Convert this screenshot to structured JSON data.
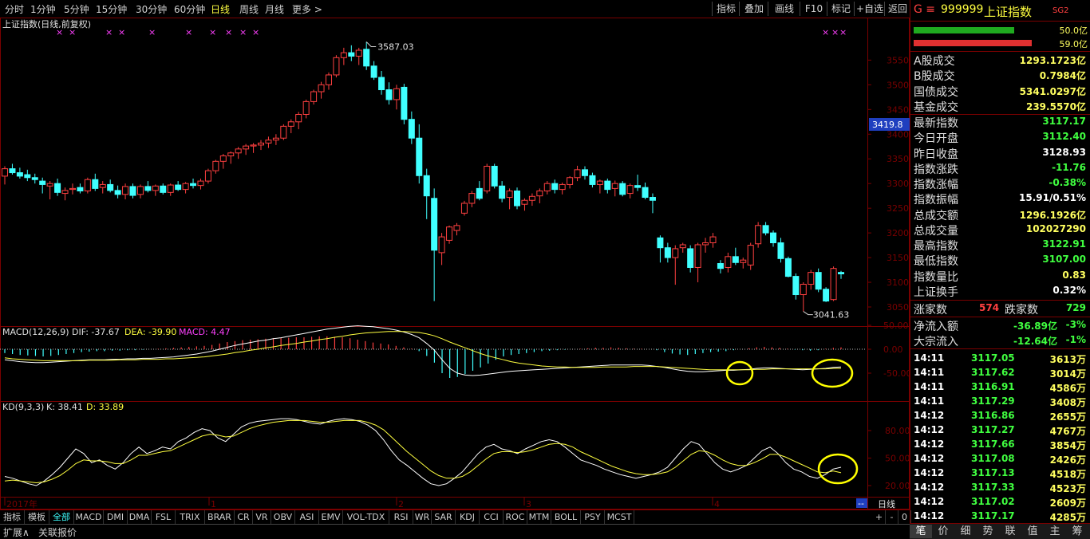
{
  "toolbar": {
    "periods": [
      "分时",
      "1分钟",
      "5分钟",
      "15分钟",
      "30分钟",
      "60分钟",
      "日线",
      "周线",
      "月线",
      "更多 >"
    ],
    "active_period": "日线",
    "buttons": [
      "指标",
      "叠加",
      "画线",
      "F10",
      "标记",
      "+自选",
      "返回"
    ]
  },
  "main_chart": {
    "title": "上证指数(日线,前复权)",
    "high_label": "3587.03",
    "low_label": "3041.63",
    "current_price_tag": "3419.8",
    "price_ticks": [
      "3550",
      "3500",
      "3450",
      "3400",
      "3350",
      "3300",
      "3250",
      "3200",
      "3150",
      "3100",
      "3050"
    ]
  },
  "macd": {
    "label": "MACD(12,26,9)",
    "dif": "DIF: -37.67",
    "dea": "DEA: -39.90",
    "macd": "MACD: 4.47",
    "ticks": [
      "50.00",
      "0.00",
      "-50.00"
    ]
  },
  "kd": {
    "label": "KD(9,3,3)",
    "k": "K: 38.41",
    "d": "D: 33.89",
    "ticks": [
      "80.00",
      "50.00",
      "20.00"
    ]
  },
  "time_axis": {
    "labels": [
      "2017年",
      "1",
      "2",
      "3",
      "4"
    ],
    "period_label": "日线",
    "expand_btn": "--"
  },
  "indicator_tabs": [
    "指标",
    "模板",
    "全部",
    "MACD",
    "DMI",
    "DMA",
    "FSL",
    "TRIX",
    "BRAR",
    "CR",
    "VR",
    "OBV",
    "ASI",
    "EMV",
    "VOL-TDX",
    "RSI",
    "WR",
    "SAR",
    "KDJ",
    "CCI",
    "ROC",
    "MTM",
    "BOLL",
    "PSY",
    "MCST"
  ],
  "active_tab": "全部",
  "bottom_bar": {
    "left": "扩展∧",
    "right": "关联报价"
  },
  "zoom_controls": [
    "+",
    "-",
    "0"
  ],
  "right_panel": {
    "code_prefix": "G ≡",
    "code": "999999",
    "name": "上证指数",
    "tag": "SG2",
    "bar_values": [
      "50.0亿",
      "59.0亿"
    ],
    "stats": [
      {
        "label": "A股成交",
        "value": "1293.1723亿",
        "color": "#ffff60"
      },
      {
        "label": "B股成交",
        "value": "0.7984亿",
        "color": "#ffff60"
      },
      {
        "label": "国债成交",
        "value": "5341.0297亿",
        "color": "#ffff60"
      },
      {
        "label": "基金成交",
        "value": "239.5570亿",
        "color": "#ffff60"
      },
      {
        "label": "最新指数",
        "value": "3117.17",
        "color": "#40ff40"
      },
      {
        "label": "今日开盘",
        "value": "3112.40",
        "color": "#40ff40"
      },
      {
        "label": "昨日收盘",
        "value": "3128.93",
        "color": "#ffffff"
      },
      {
        "label": "指数涨跌",
        "value": "-11.76",
        "color": "#40ff40"
      },
      {
        "label": "指数涨幅",
        "value": "-0.38%",
        "color": "#40ff40"
      },
      {
        "label": "指数振幅",
        "value": "15.91/0.51%",
        "color": "#ffffff"
      },
      {
        "label": "总成交额",
        "value": "1296.1926亿",
        "color": "#ffff60"
      },
      {
        "label": "总成交量",
        "value": "102027290",
        "color": "#ffff60"
      },
      {
        "label": "最高指数",
        "value": "3122.91",
        "color": "#40ff40"
      },
      {
        "label": "最低指数",
        "value": "3107.00",
        "color": "#40ff40"
      },
      {
        "label": "指数量比",
        "value": "0.83",
        "color": "#ffff60"
      },
      {
        "label": "上证换手",
        "value": "0.32%",
        "color": "#ffffff"
      }
    ],
    "up_label": "涨家数",
    "up_value": "574",
    "down_label": "跌家数",
    "down_value": "729",
    "flows": [
      {
        "label": "净流入额",
        "value": "-36.89亿",
        "pct": "-3%"
      },
      {
        "label": "大宗流入",
        "value": "-12.64亿",
        "pct": "-1%"
      }
    ],
    "ticks": [
      {
        "time": "14:11",
        "price": "3117.05",
        "vol": "3613万"
      },
      {
        "time": "14:11",
        "price": "3117.62",
        "vol": "3014万"
      },
      {
        "time": "14:11",
        "price": "3116.91",
        "vol": "4586万"
      },
      {
        "time": "14:11",
        "price": "3117.29",
        "vol": "3408万"
      },
      {
        "time": "14:12",
        "price": "3116.86",
        "vol": "2655万"
      },
      {
        "time": "14:12",
        "price": "3117.27",
        "vol": "4767万"
      },
      {
        "time": "14:12",
        "price": "3117.66",
        "vol": "3854万"
      },
      {
        "time": "14:12",
        "price": "3117.08",
        "vol": "2426万"
      },
      {
        "time": "14:12",
        "price": "3117.13",
        "vol": "4518万"
      },
      {
        "time": "14:12",
        "price": "3117.33",
        "vol": "4523万"
      },
      {
        "time": "14:12",
        "price": "3117.02",
        "vol": "2609万"
      },
      {
        "time": "14:12",
        "price": "3117.17",
        "vol": "4285万"
      }
    ],
    "bottom_tabs": [
      "笔",
      "价",
      "细",
      "势",
      "联",
      "值",
      "主",
      "筹"
    ],
    "active_bottom_tab": "笔"
  },
  "colors": {
    "up": "#ff4040",
    "down": "#40ffff",
    "bg": "#000000",
    "border": "#7a0000",
    "dif": "#ffffff",
    "dea": "#ffff40",
    "highlight": "#ffff00"
  },
  "candles": [
    [
      3315,
      3335,
      3298,
      3330
    ],
    [
      3330,
      3340,
      3318,
      3322
    ],
    [
      3322,
      3332,
      3310,
      3315
    ],
    [
      3318,
      3328,
      3305,
      3312
    ],
    [
      3312,
      3320,
      3300,
      3308
    ],
    [
      3305,
      3312,
      3280,
      3298
    ],
    [
      3295,
      3305,
      3268,
      3300
    ],
    [
      3300,
      3310,
      3275,
      3282
    ],
    [
      3280,
      3292,
      3266,
      3286
    ],
    [
      3288,
      3300,
      3278,
      3290
    ],
    [
      3292,
      3300,
      3280,
      3285
    ],
    [
      3285,
      3312,
      3280,
      3308
    ],
    [
      3308,
      3320,
      3285,
      3290
    ],
    [
      3292,
      3305,
      3280,
      3298
    ],
    [
      3298,
      3308,
      3282,
      3286
    ],
    [
      3286,
      3296,
      3270,
      3278
    ],
    [
      3278,
      3300,
      3268,
      3294
    ],
    [
      3294,
      3300,
      3270,
      3276
    ],
    [
      3278,
      3298,
      3270,
      3294
    ],
    [
      3294,
      3305,
      3282,
      3286
    ],
    [
      3286,
      3298,
      3275,
      3295
    ],
    [
      3295,
      3300,
      3278,
      3282
    ],
    [
      3282,
      3300,
      3275,
      3297
    ],
    [
      3297,
      3305,
      3285,
      3288
    ],
    [
      3288,
      3303,
      3280,
      3300
    ],
    [
      3300,
      3310,
      3290,
      3296
    ],
    [
      3296,
      3310,
      3288,
      3305
    ],
    [
      3305,
      3330,
      3300,
      3326
    ],
    [
      3326,
      3348,
      3320,
      3345
    ],
    [
      3345,
      3360,
      3330,
      3356
    ],
    [
      3356,
      3365,
      3340,
      3362
    ],
    [
      3362,
      3374,
      3350,
      3370
    ],
    [
      3370,
      3380,
      3358,
      3376
    ],
    [
      3376,
      3382,
      3362,
      3378
    ],
    [
      3378,
      3388,
      3368,
      3382
    ],
    [
      3382,
      3395,
      3372,
      3388
    ],
    [
      3388,
      3400,
      3378,
      3392
    ],
    [
      3392,
      3420,
      3388,
      3416
    ],
    [
      3416,
      3430,
      3402,
      3425
    ],
    [
      3425,
      3445,
      3410,
      3440
    ],
    [
      3440,
      3470,
      3432,
      3466
    ],
    [
      3466,
      3490,
      3460,
      3486
    ],
    [
      3486,
      3506,
      3472,
      3500
    ],
    [
      3500,
      3525,
      3490,
      3520
    ],
    [
      3520,
      3560,
      3515,
      3555
    ],
    [
      3555,
      3575,
      3540,
      3565
    ],
    [
      3565,
      3580,
      3548,
      3558
    ],
    [
      3558,
      3575,
      3540,
      3570
    ],
    [
      3572,
      3587,
      3530,
      3538
    ],
    [
      3538,
      3548,
      3510,
      3515
    ],
    [
      3515,
      3528,
      3480,
      3490
    ],
    [
      3490,
      3505,
      3460,
      3470
    ],
    [
      3470,
      3500,
      3450,
      3492
    ],
    [
      3495,
      3502,
      3420,
      3430
    ],
    [
      3430,
      3446,
      3380,
      3392
    ],
    [
      3392,
      3420,
      3300,
      3316
    ],
    [
      3316,
      3330,
      3228,
      3275
    ],
    [
      3270,
      3290,
      3062,
      3165
    ],
    [
      3160,
      3200,
      3135,
      3192
    ],
    [
      3185,
      3215,
      3178,
      3212
    ],
    [
      3205,
      3220,
      3195,
      3215
    ],
    [
      3240,
      3265,
      3235,
      3260
    ],
    [
      3260,
      3285,
      3252,
      3280
    ],
    [
      3290,
      3305,
      3266,
      3270
    ],
    [
      3285,
      3340,
      3280,
      3335
    ],
    [
      3335,
      3340,
      3290,
      3295
    ],
    [
      3295,
      3305,
      3262,
      3270
    ],
    [
      3272,
      3290,
      3248,
      3285
    ],
    [
      3285,
      3292,
      3248,
      3255
    ],
    [
      3258,
      3270,
      3245,
      3266
    ],
    [
      3266,
      3280,
      3255,
      3274
    ],
    [
      3275,
      3290,
      3260,
      3285
    ],
    [
      3285,
      3305,
      3278,
      3300
    ],
    [
      3300,
      3308,
      3280,
      3288
    ],
    [
      3288,
      3302,
      3278,
      3298
    ],
    [
      3298,
      3315,
      3290,
      3312
    ],
    [
      3312,
      3336,
      3305,
      3328
    ],
    [
      3328,
      3335,
      3308,
      3316
    ],
    [
      3316,
      3322,
      3292,
      3298
    ],
    [
      3298,
      3308,
      3280,
      3305
    ],
    [
      3305,
      3310,
      3280,
      3288
    ],
    [
      3290,
      3306,
      3274,
      3300
    ],
    [
      3300,
      3305,
      3274,
      3278
    ],
    [
      3280,
      3300,
      3270,
      3296
    ],
    [
      3296,
      3318,
      3285,
      3292
    ],
    [
      3292,
      3302,
      3268,
      3272
    ],
    [
      3272,
      3280,
      3240,
      3266
    ],
    [
      3190,
      3195,
      3140,
      3170
    ],
    [
      3170,
      3180,
      3140,
      3150
    ],
    [
      3150,
      3175,
      3095,
      3168
    ],
    [
      3170,
      3180,
      3160,
      3176
    ],
    [
      3168,
      3175,
      3120,
      3130
    ],
    [
      3130,
      3180,
      3100,
      3176
    ],
    [
      3176,
      3190,
      3160,
      3180
    ],
    [
      3180,
      3200,
      3170,
      3192
    ],
    [
      3138,
      3145,
      3118,
      3128
    ],
    [
      3130,
      3160,
      3120,
      3152
    ],
    [
      3152,
      3170,
      3135,
      3140
    ],
    [
      3140,
      3150,
      3128,
      3145
    ],
    [
      3135,
      3180,
      3125,
      3175
    ],
    [
      3178,
      3222,
      3170,
      3215
    ],
    [
      3215,
      3222,
      3195,
      3200
    ],
    [
      3200,
      3205,
      3172,
      3180
    ],
    [
      3180,
      3190,
      3140,
      3148
    ],
    [
      3148,
      3152,
      3110,
      3112
    ],
    [
      3112,
      3118,
      3065,
      3075
    ],
    [
      3075,
      3100,
      3041,
      3096
    ],
    [
      3096,
      3125,
      3085,
      3120
    ],
    [
      3120,
      3128,
      3080,
      3086
    ],
    [
      3086,
      3090,
      3060,
      3062
    ],
    [
      3065,
      3132,
      3062,
      3128
    ],
    [
      3120,
      3123,
      3107,
      3117
    ]
  ],
  "macd_hist": [
    -8,
    -10,
    -12,
    -13,
    -14,
    -15,
    -14,
    -12,
    -10,
    -8,
    -6,
    -5,
    -4,
    -4,
    -3,
    -3,
    -2,
    -2,
    -1,
    0,
    1,
    2,
    3,
    4,
    5,
    6,
    7,
    9,
    12,
    15,
    17,
    19,
    20,
    21,
    22,
    23,
    24,
    24,
    25,
    25,
    26,
    27,
    27,
    26,
    25,
    23,
    20,
    17,
    14,
    12,
    10,
    7,
    4,
    1,
    -4,
    -14,
    -28,
    -50,
    -60,
    -58,
    -52,
    -45,
    -38,
    -30,
    -22,
    -15,
    -12,
    -10,
    -8,
    -6,
    -4,
    -3,
    -2,
    -1,
    0,
    1,
    2,
    3,
    3,
    4,
    3,
    2,
    1,
    1,
    0,
    -2,
    -6,
    -9,
    -11,
    -12,
    -10,
    -8,
    -6,
    -5,
    -4,
    -2,
    0,
    2,
    4,
    5,
    4,
    3,
    1,
    -1,
    -2,
    -3,
    -2,
    1,
    3,
    4
  ],
  "dif_line": [
    -22,
    -24,
    -26,
    -27,
    -28,
    -28,
    -27,
    -26,
    -25,
    -24,
    -23,
    -22,
    -22,
    -22,
    -21,
    -21,
    -20,
    -20,
    -19,
    -19,
    -18,
    -17,
    -16,
    -14,
    -12,
    -10,
    -7,
    -4,
    0,
    4,
    8,
    11,
    14,
    17,
    19,
    22,
    24,
    27,
    30,
    33,
    36,
    39,
    42,
    44,
    46,
    48,
    49,
    48,
    47,
    45,
    43,
    40,
    36,
    31,
    24,
    12,
    -2,
    -22,
    -40,
    -50,
    -54,
    -55,
    -54,
    -52,
    -50,
    -48,
    -46,
    -45,
    -44,
    -43,
    -42,
    -41,
    -40,
    -39,
    -38,
    -37,
    -36,
    -35,
    -34,
    -33,
    -33,
    -33,
    -33,
    -33,
    -34,
    -36,
    -38,
    -41,
    -44,
    -46,
    -47,
    -47,
    -46,
    -45,
    -44,
    -44,
    -43,
    -42,
    -40,
    -39,
    -39,
    -40,
    -41,
    -42,
    -43,
    -42,
    -41,
    -40,
    -38,
    -37
  ],
  "dea_line": [
    -18,
    -20,
    -21,
    -22,
    -23,
    -24,
    -24,
    -24,
    -24,
    -24,
    -24,
    -23,
    -23,
    -23,
    -23,
    -22,
    -22,
    -22,
    -21,
    -21,
    -21,
    -20,
    -20,
    -19,
    -18,
    -17,
    -16,
    -14,
    -12,
    -10,
    -7,
    -5,
    -2,
    0,
    3,
    5,
    8,
    10,
    12,
    15,
    17,
    20,
    22,
    25,
    27,
    30,
    32,
    34,
    35,
    36,
    37,
    37,
    37,
    36,
    35,
    32,
    28,
    22,
    15,
    9,
    3,
    -3,
    -9,
    -14,
    -18,
    -22,
    -26,
    -29,
    -31,
    -33,
    -35,
    -36,
    -37,
    -37,
    -38,
    -38,
    -38,
    -38,
    -37,
    -37,
    -37,
    -37,
    -36,
    -36,
    -36,
    -36,
    -37,
    -38,
    -39,
    -40,
    -41,
    -42,
    -43,
    -43,
    -43,
    -43,
    -43,
    -43,
    -42,
    -42,
    -41,
    -41,
    -41,
    -41,
    -41,
    -41,
    -41,
    -41,
    -40,
    -40
  ],
  "k_line": [
    30,
    28,
    25,
    22,
    20,
    25,
    32,
    40,
    50,
    60,
    55,
    45,
    48,
    42,
    38,
    45,
    55,
    62,
    55,
    58,
    62,
    60,
    68,
    72,
    78,
    82,
    80,
    72,
    68,
    76,
    84,
    88,
    90,
    91,
    92,
    93,
    93,
    92,
    90,
    88,
    87,
    90,
    92,
    93,
    92,
    90,
    86,
    80,
    70,
    58,
    48,
    42,
    35,
    28,
    22,
    20,
    22,
    28,
    35,
    45,
    55,
    62,
    65,
    60,
    58,
    55,
    60,
    64,
    68,
    70,
    68,
    62,
    55,
    48,
    45,
    42,
    38,
    35,
    32,
    30,
    28,
    30,
    32,
    35,
    40,
    50,
    60,
    68,
    65,
    55,
    45,
    38,
    35,
    38,
    42,
    50,
    58,
    62,
    55,
    45,
    38,
    35,
    30,
    28,
    32,
    38,
    40
  ],
  "d_line": [
    25,
    26,
    25,
    24,
    23,
    24,
    27,
    31,
    37,
    44,
    48,
    47,
    47,
    46,
    44,
    44,
    48,
    53,
    53,
    55,
    57,
    58,
    62,
    66,
    70,
    74,
    76,
    75,
    73,
    74,
    78,
    82,
    85,
    87,
    89,
    90,
    91,
    91,
    91,
    90,
    89,
    89,
    90,
    91,
    91,
    91,
    89,
    86,
    81,
    73,
    65,
    57,
    50,
    43,
    36,
    31,
    28,
    28,
    30,
    35,
    42,
    49,
    55,
    57,
    57,
    56,
    57,
    59,
    62,
    65,
    66,
    65,
    62,
    57,
    53,
    49,
    45,
    41,
    38,
    35,
    33,
    32,
    32,
    33,
    35,
    40,
    47,
    54,
    58,
    57,
    53,
    48,
    44,
    42,
    42,
    45,
    49,
    54,
    54,
    51,
    47,
    43,
    39,
    35,
    34,
    36,
    34
  ]
}
